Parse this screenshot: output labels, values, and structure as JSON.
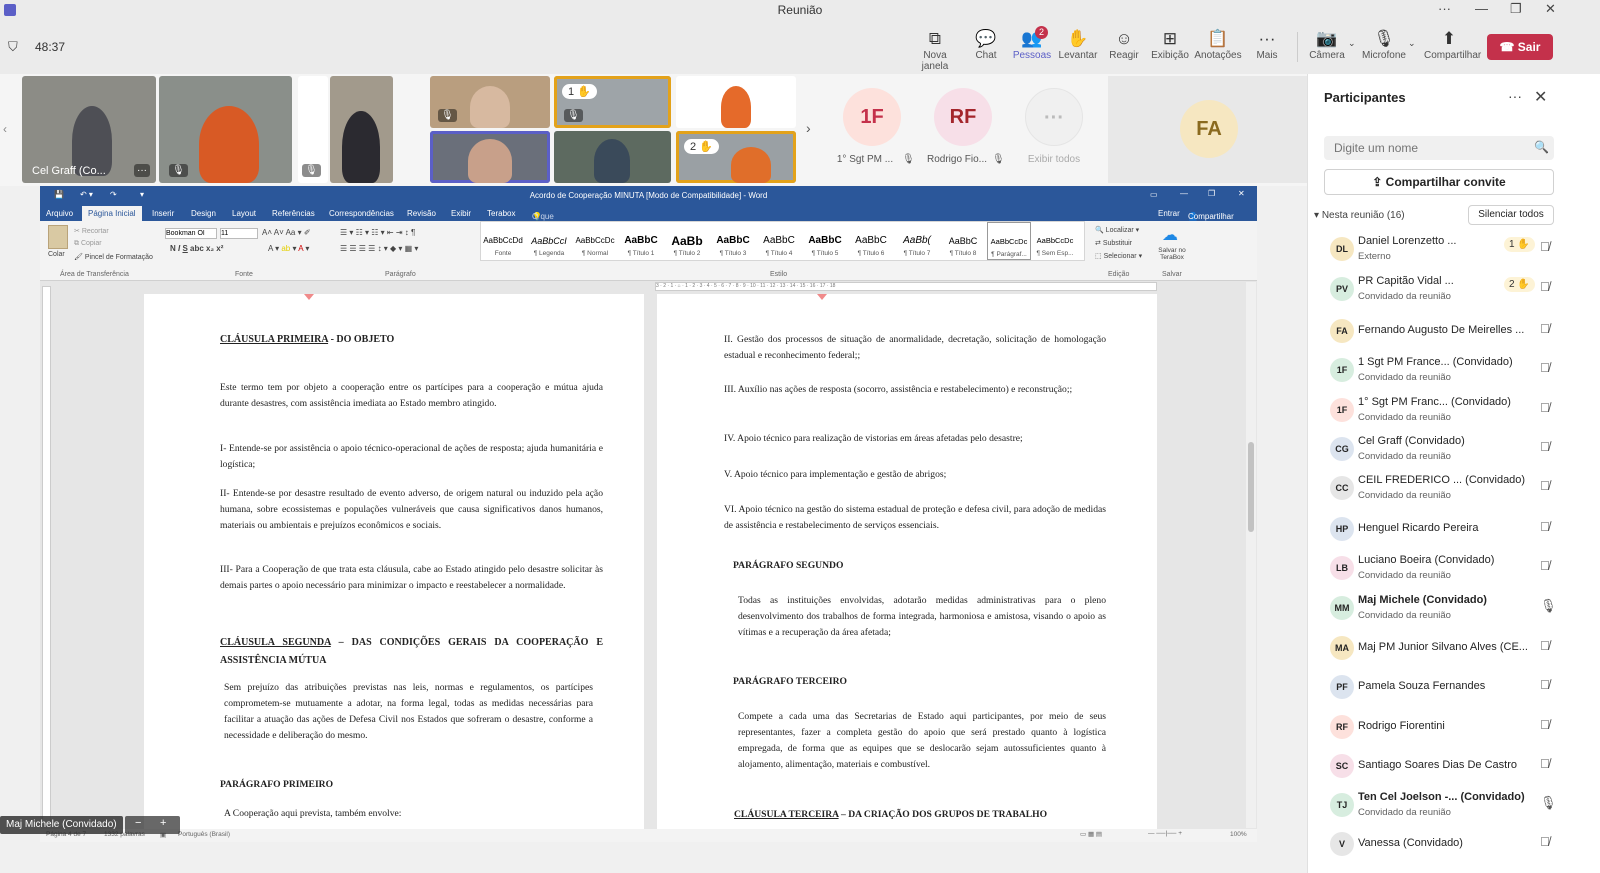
{
  "window": {
    "title": "Reunião"
  },
  "toolbar": {
    "timer": "48:37",
    "buttons": [
      {
        "label": "Nova janela",
        "icon": "new-window-icon"
      },
      {
        "label": "Chat",
        "icon": "chat-icon"
      },
      {
        "label": "Pessoas",
        "icon": "people-icon",
        "badge": "2"
      },
      {
        "label": "Levantar",
        "icon": "raise-hand-icon"
      },
      {
        "label": "Reagir",
        "icon": "react-icon"
      },
      {
        "label": "Exibição",
        "icon": "view-icon"
      },
      {
        "label": "Anotações",
        "icon": "notes-icon"
      },
      {
        "label": "Mais",
        "icon": "more-icon"
      },
      {
        "label": "Câmera",
        "icon": "camera-off-icon"
      },
      {
        "label": "Microfone",
        "icon": "mic-off-icon"
      },
      {
        "label": "Compartilhar",
        "icon": "share-icon"
      }
    ],
    "leave": "Sair",
    "accent": "#5b5fc7",
    "leave_color": "#c4314b"
  },
  "video": {
    "tile1_name": "Cel Graff (Co...",
    "hand1": "1 ✋",
    "hand2": "2 ✋",
    "avatars": [
      {
        "initials": "1F",
        "caption": "1° Sgt PM ..."
      },
      {
        "initials": "RF",
        "caption": "Rodrigo Fio..."
      },
      {
        "initials": "···",
        "caption": "Exibir todos"
      }
    ],
    "big_avatar": "FA"
  },
  "word": {
    "title": "Acordo de Cooperação MINUTA [Modo de Compatibilidade] - Word",
    "tabs": [
      "Arquivo",
      "Página Inicial",
      "Inserir",
      "Design",
      "Layout",
      "Referências",
      "Correspondências",
      "Revisão",
      "Exibir",
      "Terabox"
    ],
    "tell_me": "O que você deseja fazer...",
    "signin": "Entrar",
    "share": "Compartilhar",
    "clipboard": {
      "paste": "Colar",
      "cut": "Recortar",
      "copy": "Copiar",
      "format_painter": "Pincel de Formatação",
      "group": "Área de Transferência"
    },
    "font": {
      "name": "Bookman Ol",
      "size": "11",
      "group": "Fonte"
    },
    "paragraph_group": "Parágrafo",
    "styles": [
      {
        "sample": "AaBbCcDd",
        "name": "Fonte"
      },
      {
        "sample": "AaBbCcI",
        "name": "¶ Legenda"
      },
      {
        "sample": "AaBbCcDc",
        "name": "¶ Normal"
      },
      {
        "sample": "AaBbC",
        "name": "¶ Título 1"
      },
      {
        "sample": "AaBb",
        "name": "¶ Título 2"
      },
      {
        "sample": "AaBbC",
        "name": "¶ Título 3"
      },
      {
        "sample": "AaBbC",
        "name": "¶ Título 4"
      },
      {
        "sample": "AaBbC",
        "name": "¶ Título 5"
      },
      {
        "sample": "AaBbC",
        "name": "¶ Título 6"
      },
      {
        "sample": "AaBb(",
        "name": "¶ Título 7"
      },
      {
        "sample": "AaBbC",
        "name": "¶ Título 8"
      },
      {
        "sample": "AaBbCcDc",
        "name": "¶ Parágraf..."
      },
      {
        "sample": "AaBbCcDc",
        "name": "¶ Sem Esp..."
      }
    ],
    "styles_group": "Estilo",
    "edit": {
      "find": "Localizar",
      "replace": "Substituir",
      "select": "Selecionar",
      "group": "Edição"
    },
    "save": {
      "label": "Salvar no TeraBox",
      "group": "Salvar"
    },
    "status": {
      "page": "Página 4 de 7",
      "words": "1332 palavras",
      "lang": "Português (Brasil)",
      "zoom": "100%"
    },
    "ruler_text": "3 · 2 · 1 · ⌂ · 1 · 2 · 3 · 4 · 5 · 6 · 7 · 8 · 9 · 10 · 11 · 12 · 13 · 14 · 15 · 16 · 17 · 18",
    "left_page": {
      "h1": "CLÁUSULA PRIMEIRA",
      "h1b": " -  DO OBJETO",
      "p1": "Este termo tem por objeto a cooperação entre os partícipes para a cooperação e mútua ajuda durante desastres, com assistência imediata ao Estado membro atingido.",
      "p2": "I- Entende-se por assistência o apoio técnico-operacional de ações de resposta; ajuda humanitária e logística;",
      "p3": "II- Entende-se por desastre resultado de evento adverso, de origem natural ou induzido pela ação humana, sobre ecossistemas e populações vulneráveis que causa significativos danos humanos, materiais ou ambientais e prejuízos econômicos e sociais.",
      "p4": "III- Para a Cooperação de que trata esta cláusula, cabe ao Estado atingido pelo desastre solicitar às demais partes o apoio necessário para minimizar o impacto e reestabelecer a normalidade.",
      "h2": "CLÁUSULA SEGUNDA",
      "h2b": " – DAS CONDIÇÕES GERAIS DA COOPERAÇÃO E ASSISTÊNCIA MÚTUA",
      "p5": "Sem prejuízo das atribuições previstas nas leis, normas e regulamentos, os partícipes comprometem-se mutuamente a adotar, na forma legal, todas as medidas necessárias para facilitar a atuação das ações de Defesa Civil nos Estados que sofreram o desastre, conforme a necessidade e deliberação do mesmo.",
      "h3": "PARÁGRAFO PRIMEIRO",
      "p6": "A Cooperação aqui prevista, também envolve:"
    },
    "right_page": {
      "i2": "II.     Gestão dos processos de situação de anormalidade, decretação, solicitação de homologação estadual e reconhecimento federal;;",
      "i3": "III.     Auxílio nas ações de resposta (socorro, assistência e restabelecimento) e reconstrução;;",
      "i4": "IV.     Apoio técnico para realização de vistorias em áreas afetadas pelo desastre;",
      "i5": "V.      Apoio técnico para implementação e gestão de abrigos;",
      "i6": "VI.     Apoio técnico na gestão do sistema estadual de proteção e defesa civil, para adoção de medidas de assistência e restabelecimento de serviços essenciais.",
      "h4": "PARÁGRAFO SEGUNDO",
      "p7": "Todas as instituições envolvidas, adotarão medidas administrativas para o pleno desenvolvimento dos trabalhos de forma integrada, harmoniosa e amistosa, visando o apoio as vítimas e a recuperação da área afetada;",
      "h5": "PARÁGRAFO TERCEIRO",
      "p8": "Compete a cada uma das Secretarias de Estado aqui participantes, por meio de seus representantes, fazer a completa gestão do apoio que será prestado quanto à logística empregada, de forma que as equipes que se deslocarão sejam autossuficientes quanto à alojamento, alimentação, materiais e combustível.",
      "h6": "CLÁUSULA TERCEIRA",
      "h6b": " – DA CRIAÇÃO DOS GRUPOS DE TRABALHO"
    }
  },
  "presenter_chip": "Maj Michele (Convidado)",
  "panel": {
    "title": "Participantes",
    "search_placeholder": "Digite um nome",
    "share_invite": "Compartilhar convite",
    "in_meeting": "Nesta reunião (16)",
    "mute_all": "Silenciar todos",
    "people": [
      {
        "initials": "DL",
        "name": "Daniel Lorenzetto ...",
        "sub": "Externo",
        "hand": "1 ✋",
        "color": "#f6e7c1",
        "mic": "off"
      },
      {
        "initials": "PV",
        "name": "PR Capitão Vidal ...",
        "sub": "Convidado da reunião",
        "hand": "2 ✋",
        "color": "#d7eddf",
        "mic": "off"
      },
      {
        "initials": "FA",
        "name": "Fernando Augusto De Meirelles ...",
        "sub": "",
        "hand": "",
        "color": "#f6e7c1",
        "mic": "off"
      },
      {
        "initials": "1F",
        "name": "1 Sgt PM France... (Convidado)",
        "sub": "Convidado da reunião",
        "hand": "",
        "color": "#d7eddf",
        "mic": "off"
      },
      {
        "initials": "1F",
        "name": "1° Sgt PM Franc... (Convidado)",
        "sub": "Convidado da reunião",
        "hand": "",
        "color": "#fde1dc",
        "mic": "off"
      },
      {
        "initials": "CG",
        "name": "Cel Graff (Convidado)",
        "sub": "Convidado da reunião",
        "hand": "",
        "color": "#dce4ef",
        "mic": "off"
      },
      {
        "initials": "CC",
        "name": "CEIL FREDERICO ... (Convidado)",
        "sub": "Convidado da reunião",
        "hand": "",
        "color": "#e6e6e6",
        "mic": "off"
      },
      {
        "initials": "HP",
        "name": "Henguel Ricardo Pereira",
        "sub": "",
        "hand": "",
        "color": "#dce4ef",
        "mic": "off"
      },
      {
        "initials": "LB",
        "name": "Luciano Boeira (Convidado)",
        "sub": "Convidado da reunião",
        "hand": "",
        "color": "#f7dfe8",
        "mic": "off"
      },
      {
        "initials": "MM",
        "name": "Maj Michele (Convidado)",
        "sub": "Convidado da reunião",
        "hand": "",
        "color": "#d7eddf",
        "mic": "on"
      },
      {
        "initials": "MA",
        "name": "Maj PM Junior Silvano Alves (CE...",
        "sub": "",
        "hand": "",
        "color": "#f6e7c1",
        "mic": "off"
      },
      {
        "initials": "PF",
        "name": "Pamela Souza Fernandes",
        "sub": "",
        "hand": "",
        "color": "#dce4ef",
        "mic": "off"
      },
      {
        "initials": "RF",
        "name": "Rodrigo Fiorentini",
        "sub": "",
        "hand": "",
        "color": "#fde1dc",
        "mic": "off"
      },
      {
        "initials": "SC",
        "name": "Santiago Soares Dias De Castro",
        "sub": "",
        "hand": "",
        "color": "#f7dfe8",
        "mic": "off"
      },
      {
        "initials": "TJ",
        "name": "Ten Cel Joelson -... (Convidado)",
        "sub": "Convidado da reunião",
        "hand": "",
        "color": "#d7eddf",
        "mic": "on"
      },
      {
        "initials": "V",
        "name": "Vanessa (Convidado)",
        "sub": "",
        "hand": "",
        "color": "#e6e6e6",
        "mic": "off"
      }
    ]
  }
}
